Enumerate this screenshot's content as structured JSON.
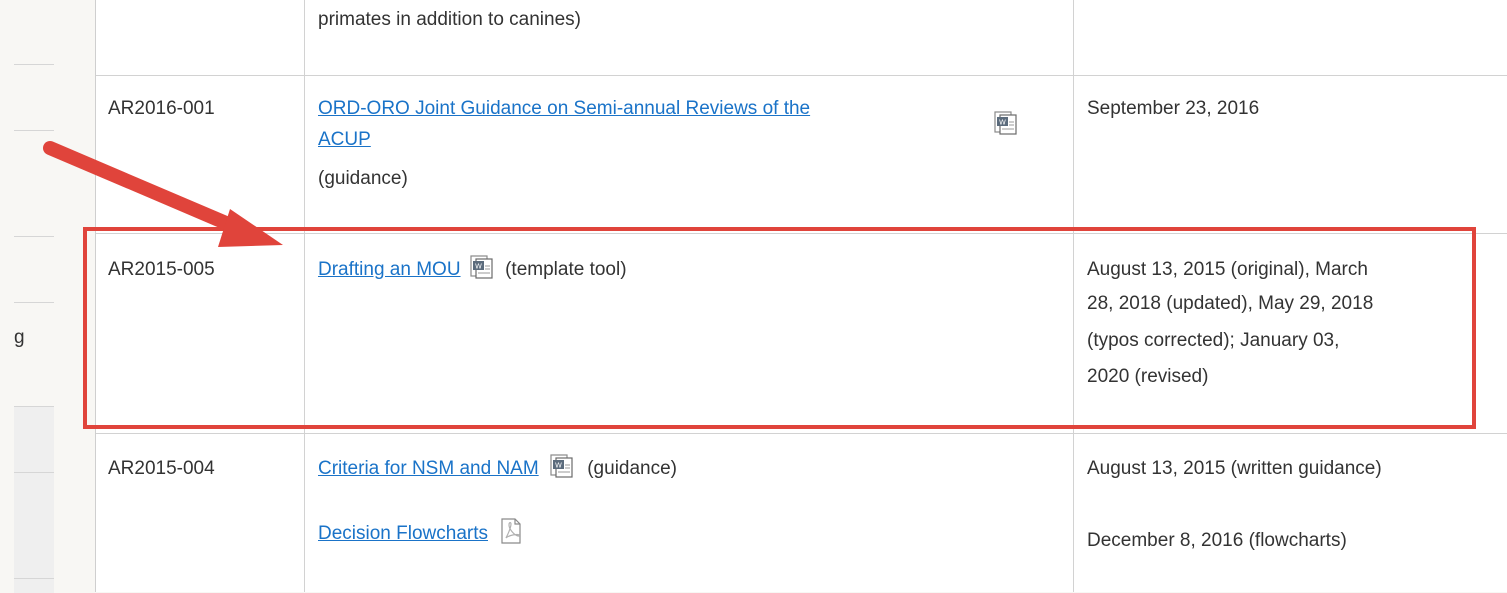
{
  "rows": [
    {
      "id": "",
      "title_prefix": "primates in addition to canines)",
      "date": ""
    },
    {
      "id": "AR2016-001",
      "title_line1": "ORD-ORO Joint Guidance on Semi-annual Reviews of the",
      "title_line2": "ACUP",
      "note": "(guidance)",
      "icon": "word-doc-icon",
      "date": "September 23, 2016"
    },
    {
      "id": "AR2015-005",
      "title": "Drafting an MOU",
      "note": "(template tool)",
      "icon": "word-doc-icon",
      "date_lines": [
        "August 13, 2015 (original), March",
        "28, 2018 (updated), May 29, 2018",
        "(typos corrected); January 03,",
        "2020 (revised)"
      ]
    },
    {
      "id": "AR2015-004",
      "title": "Criteria for NSM and NAM",
      "note": "(guidance)",
      "icon": "word-doc-icon",
      "link2": "Decision Flowcharts",
      "icon2": "pdf-icon",
      "date": "August 13, 2015 (written guidance)",
      "date2": "December 8, 2016 (flowcharts)"
    }
  ],
  "sidebar": {
    "partial_text": "g"
  },
  "annotation": {
    "color": "#e0443b",
    "type": "red arrow and box"
  }
}
